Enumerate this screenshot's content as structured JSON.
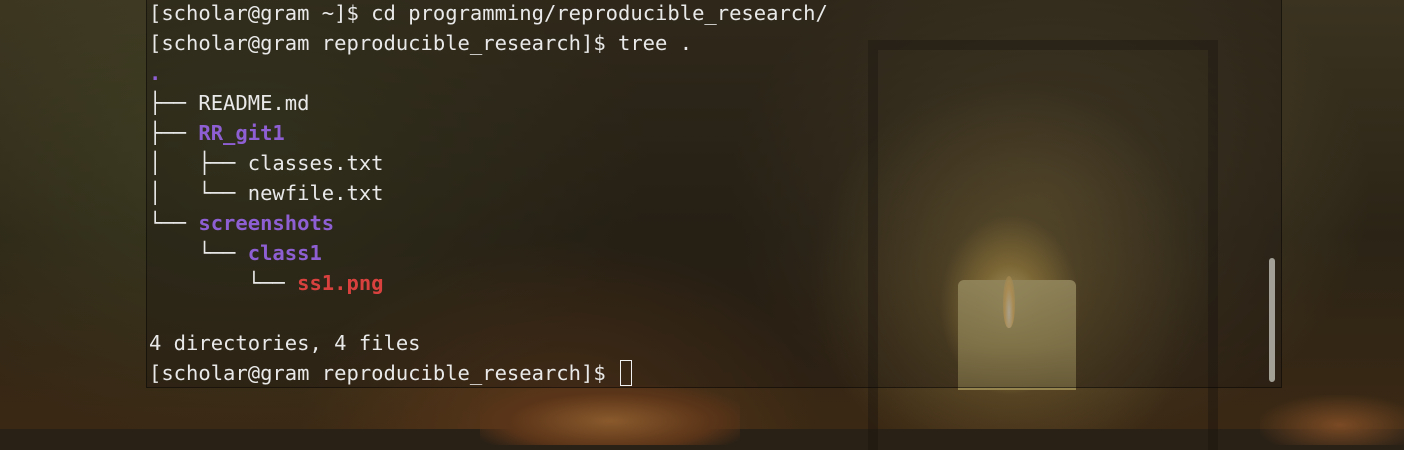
{
  "terminal": {
    "lines": [
      {
        "prompt": "[scholar@gram ~]$ ",
        "command": "cd programming/reproducible_research/"
      },
      {
        "prompt": "[scholar@gram reproducible_research]$ ",
        "command": "tree ."
      }
    ],
    "tree": {
      "root": ".",
      "items": [
        {
          "prefix": "├── ",
          "name": "README.md",
          "kind": "file"
        },
        {
          "prefix": "├── ",
          "name": "RR_git1",
          "kind": "directory"
        },
        {
          "prefix": "│   ├── ",
          "name": "classes.txt",
          "kind": "file"
        },
        {
          "prefix": "│   └── ",
          "name": "newfile.txt",
          "kind": "file"
        },
        {
          "prefix": "└── ",
          "name": "screenshots",
          "kind": "directory"
        },
        {
          "prefix": "    └── ",
          "name": "class1",
          "kind": "directory"
        },
        {
          "prefix": "        └── ",
          "name": "ss1.png",
          "kind": "image"
        }
      ]
    },
    "summary": "4 directories, 4 files",
    "current_prompt": "[scholar@gram reproducible_research]$ ",
    "colors": {
      "text": "#e9e9e9",
      "directory": "#8d5fd3",
      "image": "#d9413f"
    }
  }
}
